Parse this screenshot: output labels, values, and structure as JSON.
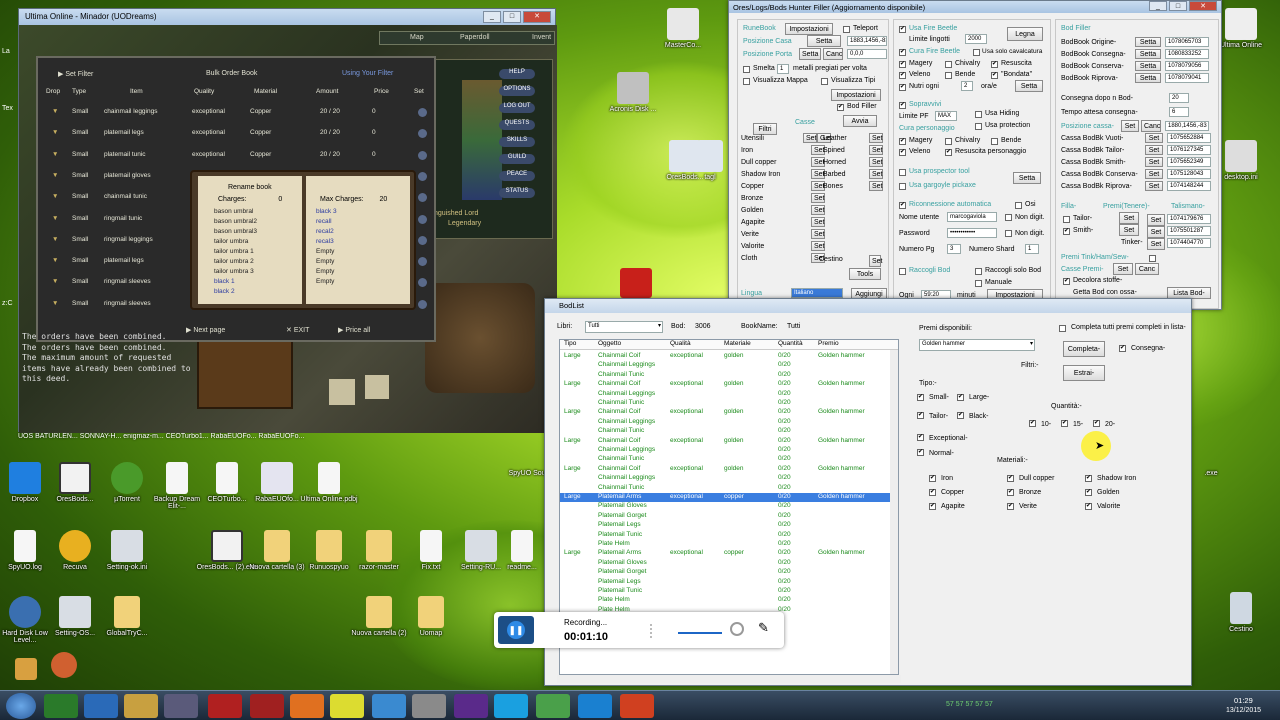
{
  "desktop": {
    "left_labels": [
      "La",
      "Tex",
      "z:C"
    ],
    "icons_right": [
      {
        "label": "MasterCo..."
      },
      {
        "label": "Acronis Disk ..."
      },
      {
        "label": "OresBods..."
      },
      {
        "label": "tagl"
      },
      {
        "label": "Ultima Online"
      },
      {
        "label": "desktop.ini"
      },
      {
        "label": "Cestino"
      }
    ],
    "icons_bottom": [
      {
        "label": "Dropbox"
      },
      {
        "label": "OresBods..."
      },
      {
        "label": "µTorrent"
      },
      {
        "label": "Backup Dream Elit-..."
      },
      {
        "label": "CEOTurbo..."
      },
      {
        "label": "RabaEUOfo..."
      },
      {
        "label": "Ultima Online.pdbj"
      },
      {
        "label": "SpyUO.log"
      },
      {
        "label": "Recuva"
      },
      {
        "label": "Setting-ok.ini"
      },
      {
        "label": "OresBods... (2).exe"
      },
      {
        "label": "Nuova cartella (3)"
      },
      {
        "label": "Runuospyuo"
      },
      {
        "label": "razor-master"
      },
      {
        "label": "Fix.txt"
      },
      {
        "label": "Setting-RU..."
      },
      {
        "label": "readme..."
      },
      {
        "label": "Hard Disk Low Level..."
      },
      {
        "label": "Setting-OS..."
      },
      {
        "label": "GlobalTryC..."
      },
      {
        "label": "Nuova cartella (2)"
      },
      {
        "label": "Uomap"
      },
      {
        "label": "SpyUO Sourc"
      },
      {
        "label": ".exe"
      }
    ],
    "partial_row": "UOS   BATURLEN...   SONNAY-H...  enigmaz-m...  CEOTurbo1...   RabaEUOFo...   RabaEUOFo..."
  },
  "uo": {
    "title": "Ultima Online - Minador (UODreams)",
    "top_buttons": [
      "Map",
      "Paperdoll",
      "Invent"
    ],
    "side_buttons": [
      "HELP",
      "OPTIONS",
      "LOG OUT",
      "QUESTS",
      "SKILLS",
      "GUILD",
      "PEACE",
      "STATUS"
    ],
    "bob": {
      "set_filter": "Set Filter",
      "title": "Bulk Order Book",
      "use_filter": "Using Your Filter",
      "headers": [
        "Drop",
        "Type",
        "Item",
        "Quality",
        "Material",
        "Amount",
        "Price",
        "Set"
      ],
      "rows": [
        {
          "type": "Small",
          "item": "chainmail leggings",
          "quality": "exceptional",
          "material": "Copper",
          "amount": "20 / 20",
          "price": "0"
        },
        {
          "type": "Small",
          "item": "platemail legs",
          "quality": "exceptional",
          "material": "Copper",
          "amount": "20 / 20",
          "price": "0"
        },
        {
          "type": "Small",
          "item": "platemail tunic",
          "quality": "exceptional",
          "material": "Copper",
          "amount": "20 / 20",
          "price": "0"
        },
        {
          "type": "Small",
          "item": "platemail gloves",
          "quality": "",
          "material": "",
          "amount": "",
          "price": ""
        },
        {
          "type": "Small",
          "item": "chainmail tunic",
          "quality": "",
          "material": "",
          "amount": "",
          "price": ""
        },
        {
          "type": "Small",
          "item": "ringmail tunic",
          "quality": "",
          "material": "",
          "amount": "",
          "price": ""
        },
        {
          "type": "Small",
          "item": "ringmail leggings",
          "quality": "",
          "material": "",
          "amount": "",
          "price": ""
        },
        {
          "type": "Small",
          "item": "platemail legs",
          "quality": "",
          "material": "",
          "amount": "",
          "price": ""
        },
        {
          "type": "Small",
          "item": "ringmail sleeves",
          "quality": "",
          "material": "",
          "amount": "",
          "price": ""
        },
        {
          "type": "Small",
          "item": "ringmail sleeves",
          "quality": "",
          "material": "",
          "amount": "",
          "price": ""
        }
      ],
      "next_page": "Next page",
      "exit": "EXIT",
      "price_all": "Price all"
    },
    "rune": {
      "title": "Rename book",
      "charges": "Charges:",
      "charges_val": "0",
      "max_charges": "Max Charges:",
      "max_val": "20",
      "left": [
        "bason umbral",
        "bason umbral2",
        "bason umbral3",
        "tailor umbra",
        "tailor umbra 1",
        "tailor umbra 2",
        "tailor umbra 3",
        "black 1",
        "black 2"
      ],
      "right": [
        "black 3",
        "recall",
        "recal2",
        "recal3",
        "Empty",
        "Empty",
        "Empty",
        "Empty"
      ]
    },
    "messages": [
      "The orders have been combined.",
      "The orders have been combined.",
      "The maximum amount of requested",
      "items have already been combined to",
      "this deed."
    ],
    "guild_text": [
      "nguished Lord",
      "Legendary"
    ]
  },
  "filler": {
    "title": "Ores/Logs/Bods Hunter Filler (Aggiornamento disponibile)",
    "runebook": "RuneBook",
    "impostazioni": "Impostazioni",
    "teleport": "Teleport",
    "posizione_casa": "Posizione Casa",
    "setta": "Setta",
    "casa_val": "1883,1456,-83",
    "posizione_porta": "Posizione Porta",
    "canc": "Canc",
    "porta_val": "0,0,0",
    "smelta": "Smelta",
    "smelta_num": "1",
    "metalli": "metalli pregiati per volta",
    "visualizza_mappa": "Visualizza Mappa",
    "visualizza_tipi": "Visualizza Tipi",
    "impostazioni2": "Impostazioni",
    "bod_filler": "Bod Filler",
    "filtri": "Filtri",
    "avvia": "Avvia",
    "casse": "Casse",
    "materials_left": [
      "Utensili",
      "Iron",
      "Dull copper",
      "Shadow Iron",
      "Copper",
      "Bronze",
      "Golden",
      "Agapite",
      "Verite",
      "Valorite",
      "Cloth"
    ],
    "materials_right": [
      "Leather",
      "Spined",
      "Horned",
      "Barbed",
      "Bones"
    ],
    "set": "Set",
    "get": "Get",
    "cestino": "Cestino",
    "tools": "Tools",
    "lingua": "Lingua",
    "lingua_val": "Italiano",
    "aggiungi": "Aggiungi",
    "usa_fire_beetle": "Usa Fire Beetle",
    "limite_lingotti": "Limite lingotti",
    "limite_val": "2000",
    "legna": "Legna",
    "cura_fire_beetle": "Cura Fire Beetle",
    "usa_solo_cavalcatura": "Usa solo cavalcatura",
    "magery": "Magery",
    "chivalry": "Chivalry",
    "resuscita": "Resuscita",
    "veleno": "Veleno",
    "bende": "Bende",
    "bondata": "\"Bondata\"",
    "nutri_ogni": "Nutri ogni",
    "nutri_val": "2",
    "ora_e": "ora/e",
    "sopravvivi": "Sopravvivi",
    "limite_pf": "Limite PF",
    "limite_pf_val": "MAX",
    "usa_hiding": "Usa Hiding",
    "usa_protection": "Usa protection",
    "cura_personaggio": "Cura personaggio",
    "resuscita_personaggio": "Resuscita personaggio",
    "usa_prospector": "Usa prospector tool",
    "usa_gargoyle": "Usa gargoyle pickaxe",
    "riconnessione": "Riconnessione automatica",
    "osi": "Osi",
    "nome_utente": "Nome utente",
    "nome_val": "marcogaviola",
    "non_digit": "Non digit.",
    "password": "Password",
    "password_val": "••••••••••••",
    "numero_pg": "Numero Pg",
    "pg_val": "3",
    "numero_shard": "Numero Shard",
    "shard_val": "1",
    "raccogli_bod": "Raccogli Bod",
    "raccogli_solo": "Raccogli solo Bod",
    "manuale": "Manuale",
    "ogni": "Ogni",
    "ogni_val": "59:20",
    "minuti": "minuti",
    "impostazioni3": "Impostazioni",
    "bod_filler_title": "Bod Filler",
    "bodbook_rows": [
      {
        "label": "BodBook Origine-",
        "val": "1078065703"
      },
      {
        "label": "BodBook Consegna-",
        "val": "1080833252"
      },
      {
        "label": "BodBook Conserva-",
        "val": "1078079056"
      },
      {
        "label": "BodBook Riprova-",
        "val": "1078079041"
      }
    ],
    "consegna_dopo": "Consegna dopo n Bod-",
    "consegna_val": "20",
    "tempo_attesa": "Tempo attesa consegna-",
    "tempo_val": "6",
    "posizione_cassa": "Posizione cassa-",
    "cassa_pos_val": "1880,1456,-83",
    "casse_rows": [
      {
        "label": "Cassa BodBk Vuoti-",
        "val": "1075652884"
      },
      {
        "label": "Cassa BodBk Tailor-",
        "val": "1076127345"
      },
      {
        "label": "Cassa BodBk Smith-",
        "val": "1075652349"
      },
      {
        "label": "Cassa BodBk Conserva-",
        "val": "1075128043"
      },
      {
        "label": "Cassa BodBk Riprova-",
        "val": "1074148244"
      }
    ],
    "filla": "Filla-",
    "premi_tenere": "Premi(Tenere)-",
    "talismano": "Talismano-",
    "tailor": "Tailor-",
    "smith": "Smith-",
    "tinker": "Tinker-",
    "tal_vals": [
      "1074179676",
      "1075501287",
      "1074404770"
    ],
    "premi_tink": "Premi Tink/Ham/Sew-",
    "casse_premi": "Casse Premi-",
    "decolora": "Decolora stoffe-",
    "getta_bod": "Getta Bod con ossa-",
    "lista_bod": "Lista Bod-"
  },
  "bodlist": {
    "title": "BodList",
    "libri_label": "Libri:",
    "libri_val": "Tutti",
    "bod_label": "Bod:",
    "bod_val": "3006",
    "bookname_label": "BookName:",
    "bookname_val": "Tutti",
    "headers": [
      "Tipo",
      "Oggetto",
      "Qualità",
      "Materiale",
      "Quantità",
      "Premio"
    ],
    "rows": [
      {
        "tipo": "Large",
        "oggetto": "Chainmail Coif",
        "qualita": "exceptional",
        "materiale": "golden",
        "quantita": "0/20",
        "premio": "Golden hammer",
        "sel": false
      },
      {
        "tipo": "",
        "oggetto": "Chainmail Leggings",
        "qualita": "",
        "materiale": "",
        "quantita": "0/20",
        "premio": "",
        "sel": false
      },
      {
        "tipo": "",
        "oggetto": "Chainmail Tunic",
        "qualita": "",
        "materiale": "",
        "quantita": "0/20",
        "premio": "",
        "sel": false
      },
      {
        "tipo": "Large",
        "oggetto": "Chainmail Coif",
        "qualita": "exceptional",
        "materiale": "golden",
        "quantita": "0/20",
        "premio": "Golden hammer",
        "sel": false
      },
      {
        "tipo": "",
        "oggetto": "Chainmail Leggings",
        "qualita": "",
        "materiale": "",
        "quantita": "0/20",
        "premio": "",
        "sel": false
      },
      {
        "tipo": "",
        "oggetto": "Chainmail Tunic",
        "qualita": "",
        "materiale": "",
        "quantita": "0/20",
        "premio": "",
        "sel": false
      },
      {
        "tipo": "Large",
        "oggetto": "Chainmail Coif",
        "qualita": "exceptional",
        "materiale": "golden",
        "quantita": "0/20",
        "premio": "Golden hammer",
        "sel": false
      },
      {
        "tipo": "",
        "oggetto": "Chainmail Leggings",
        "qualita": "",
        "materiale": "",
        "quantita": "0/20",
        "premio": "",
        "sel": false
      },
      {
        "tipo": "",
        "oggetto": "Chainmail Tunic",
        "qualita": "",
        "materiale": "",
        "quantita": "0/20",
        "premio": "",
        "sel": false
      },
      {
        "tipo": "Large",
        "oggetto": "Chainmail Coif",
        "qualita": "exceptional",
        "materiale": "golden",
        "quantita": "0/20",
        "premio": "Golden hammer",
        "sel": false
      },
      {
        "tipo": "",
        "oggetto": "Chainmail Leggings",
        "qualita": "",
        "materiale": "",
        "quantita": "0/20",
        "premio": "",
        "sel": false
      },
      {
        "tipo": "",
        "oggetto": "Chainmail Tunic",
        "qualita": "",
        "materiale": "",
        "quantita": "0/20",
        "premio": "",
        "sel": false
      },
      {
        "tipo": "Large",
        "oggetto": "Chainmail Coif",
        "qualita": "exceptional",
        "materiale": "golden",
        "quantita": "0/20",
        "premio": "Golden hammer",
        "sel": false
      },
      {
        "tipo": "",
        "oggetto": "Chainmail Leggings",
        "qualita": "",
        "materiale": "",
        "quantita": "0/20",
        "premio": "",
        "sel": false
      },
      {
        "tipo": "",
        "oggetto": "Chainmail Tunic",
        "qualita": "",
        "materiale": "",
        "quantita": "0/20",
        "premio": "",
        "sel": false
      },
      {
        "tipo": "Large",
        "oggetto": "Platemail Arms",
        "qualita": "exceptional",
        "materiale": "copper",
        "quantita": "0/20",
        "premio": "Golden hammer",
        "sel": true
      },
      {
        "tipo": "",
        "oggetto": "Platemail Gloves",
        "qualita": "",
        "materiale": "",
        "quantita": "0/20",
        "premio": "",
        "sel": false
      },
      {
        "tipo": "",
        "oggetto": "Platemail Gorget",
        "qualita": "",
        "materiale": "",
        "quantita": "0/20",
        "premio": "",
        "sel": false
      },
      {
        "tipo": "",
        "oggetto": "Platemail Legs",
        "qualita": "",
        "materiale": "",
        "quantita": "0/20",
        "premio": "",
        "sel": false
      },
      {
        "tipo": "",
        "oggetto": "Platemail Tunic",
        "qualita": "",
        "materiale": "",
        "quantita": "0/20",
        "premio": "",
        "sel": false
      },
      {
        "tipo": "",
        "oggetto": "Plate Helm",
        "qualita": "",
        "materiale": "",
        "quantita": "0/20",
        "premio": "",
        "sel": false
      },
      {
        "tipo": "Large",
        "oggetto": "Platemail Arms",
        "qualita": "exceptional",
        "materiale": "copper",
        "quantita": "0/20",
        "premio": "Golden hammer",
        "sel": false
      },
      {
        "tipo": "",
        "oggetto": "Platemail Gloves",
        "qualita": "",
        "materiale": "",
        "quantita": "0/20",
        "premio": "",
        "sel": false
      },
      {
        "tipo": "",
        "oggetto": "Platemail Gorget",
        "qualita": "",
        "materiale": "",
        "quantita": "0/20",
        "premio": "",
        "sel": false
      },
      {
        "tipo": "",
        "oggetto": "Platemail Legs",
        "qualita": "",
        "materiale": "",
        "quantita": "0/20",
        "premio": "",
        "sel": false
      },
      {
        "tipo": "",
        "oggetto": "Platemail Tunic",
        "qualita": "",
        "materiale": "",
        "quantita": "0/20",
        "premio": "",
        "sel": false
      },
      {
        "tipo": "",
        "oggetto": "Plate Helm",
        "qualita": "",
        "materiale": "",
        "quantita": "0/20",
        "premio": "",
        "sel": false
      },
      {
        "tipo": "",
        "oggetto": "Plate Helm",
        "qualita": "",
        "materiale": "",
        "quantita": "0/20",
        "premio": "",
        "sel": false
      }
    ],
    "premi_label": "Premi disponibili:",
    "premi_val": "Golden hammer",
    "completa_tutti": "Completa tutti premi completi in lista-",
    "completa": "Completa-",
    "consegna": "Consegna-",
    "filtri": "Filtri:-",
    "estrai": "Estrai-",
    "tipo": "Tipo:-",
    "small": "Small-",
    "large": "Large-",
    "tailor": "Tailor-",
    "black": "Black-",
    "exceptional": "Exceptional-",
    "normal": "Normal-",
    "quantita": "Quantità:-",
    "q10": "10-",
    "q15": "15-",
    "q20": "20-",
    "materiali": "Materiali:-",
    "mats": [
      [
        "Iron",
        "Dull copper",
        "Shadow Iron"
      ],
      [
        "Copper",
        "Bronze",
        "Golden"
      ],
      [
        "Agapite",
        "Verite",
        "Valorite"
      ]
    ]
  },
  "recorder": {
    "status": "Recording...",
    "time": "00:01:10"
  },
  "clock": {
    "time": "01:29",
    "date": "13/12/2015"
  },
  "tray_nums": [
    "57",
    "57",
    "57",
    "57",
    "57"
  ]
}
